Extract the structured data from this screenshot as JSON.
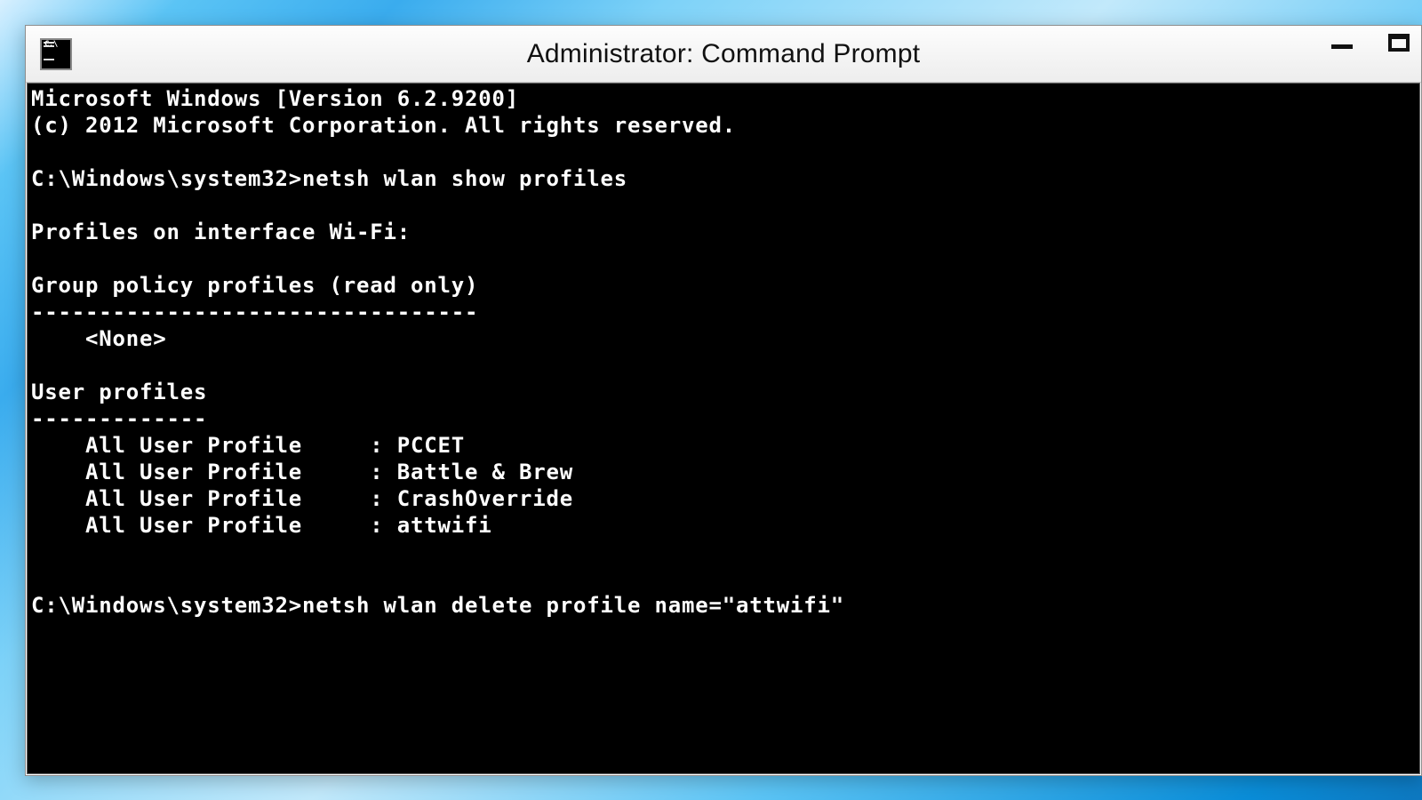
{
  "window": {
    "title": "Administrator: Command Prompt"
  },
  "terminal": {
    "header_version": "Microsoft Windows [Version 6.2.9200]",
    "header_copyright": "(c) 2012 Microsoft Corporation. All rights reserved.",
    "prompt_path": "C:\\Windows\\system32>",
    "cmd1": "netsh wlan show profiles",
    "section_interface": "Profiles on interface Wi-Fi:",
    "group_header": "Group policy profiles (read only)",
    "group_underline": "---------------------------------",
    "group_none": "    <None>",
    "user_header": "User profiles",
    "user_underline": "-------------",
    "profiles": [
      {
        "label": "    All User Profile     : ",
        "name": "PCCET"
      },
      {
        "label": "    All User Profile     : ",
        "name": "Battle & Brew"
      },
      {
        "label": "    All User Profile     : ",
        "name": "CrashOverride"
      },
      {
        "label": "    All User Profile     : ",
        "name": "attwifi"
      }
    ],
    "cmd2": "netsh wlan delete profile name=\"attwifi\""
  }
}
